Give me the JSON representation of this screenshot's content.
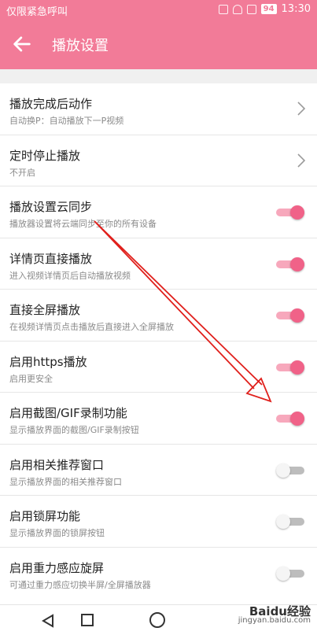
{
  "status_bar": {
    "carrier": "仅限紧急呼叫",
    "battery": "94",
    "time": "13:30"
  },
  "app_bar": {
    "back_icon": "arrow-left-icon",
    "title": "播放设置"
  },
  "settings": [
    {
      "title": "播放完成后动作",
      "subtitle": "自动换P：自动播放下一P视频",
      "control": "chevron"
    },
    {
      "title": "定时停止播放",
      "subtitle": "不开启",
      "control": "chevron"
    },
    {
      "title": "播放设置云同步",
      "subtitle": "播放器设置将云端同步至你的所有设备",
      "control": "toggle",
      "on": true
    },
    {
      "title": "详情页直接播放",
      "subtitle": "进入视频详情页后自动播放视频",
      "control": "toggle",
      "on": true
    },
    {
      "title": "直接全屏播放",
      "subtitle": "在视频详情页点击播放后直接进入全屏播放",
      "control": "toggle",
      "on": true
    },
    {
      "title": "启用https播放",
      "subtitle": "启用更安全",
      "control": "toggle",
      "on": true
    },
    {
      "title": "启用截图/GIF录制功能",
      "subtitle": "显示播放界面的截图/GIF录制按钮",
      "control": "toggle",
      "on": true
    },
    {
      "title": "启用相关推荐窗口",
      "subtitle": "显示播放界面的相关推荐窗口",
      "control": "toggle",
      "on": false
    },
    {
      "title": "启用锁屏功能",
      "subtitle": "显示播放界面的锁屏按钮",
      "control": "toggle",
      "on": false
    },
    {
      "title": "启用重力感应旋屏",
      "subtitle": "可通过重力感应切换半屏/全屏播放器",
      "control": "toggle",
      "on": false
    }
  ],
  "nav_bar": {
    "back_icon": "triangle-back-icon",
    "home_icon": "circle-home-icon",
    "recent_icon": "square-recent-icon"
  },
  "watermark": {
    "brand": "Baidu经验",
    "url": "jingyan.baidu.com"
  },
  "colors": {
    "accent": "#f27b98",
    "toggle_on": "#f06288",
    "annotation_arrow": "#e0201c"
  }
}
